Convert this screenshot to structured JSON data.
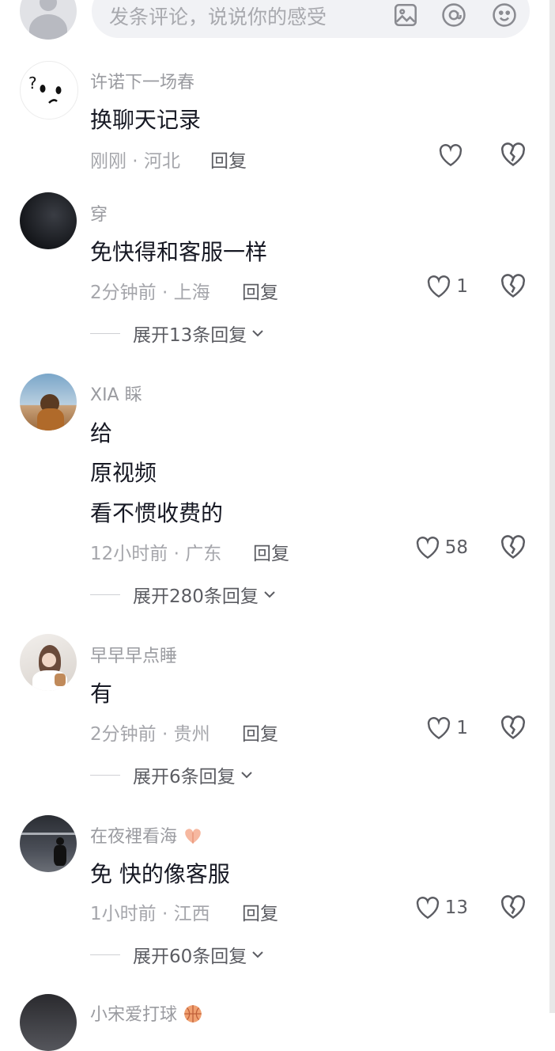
{
  "composer": {
    "placeholder": "发条评论，说说你的感受",
    "icons": [
      "image-icon",
      "at-icon",
      "emoji-icon"
    ]
  },
  "comments": [
    {
      "username": "许诺下一场春",
      "lines": [
        "换聊天记录"
      ],
      "time": "刚刚",
      "location": "河北",
      "reply_label": "回复",
      "likes": "",
      "expand_label": ""
    },
    {
      "username": "穿",
      "lines": [
        "免快得和客服一样"
      ],
      "time": "2分钟前",
      "location": "上海",
      "reply_label": "回复",
      "likes": "1",
      "expand_label": "展开13条回复"
    },
    {
      "username": "XIA 睬",
      "lines": [
        "给",
        "原视频",
        "看不惯收费的"
      ],
      "time": "12小时前",
      "location": "广东",
      "reply_label": "回复",
      "likes": "58",
      "expand_label": "展开280条回复"
    },
    {
      "username": "早早早点睡",
      "lines": [
        "有"
      ],
      "time": "2分钟前",
      "location": "贵州",
      "reply_label": "回复",
      "likes": "1",
      "expand_label": "展开6条回复"
    },
    {
      "username": "在夜裡看海",
      "lines": [
        "免 快的像客服"
      ],
      "time": "1小时前",
      "location": "江西",
      "reply_label": "回复",
      "likes": "13",
      "expand_label": "展开60条回复"
    },
    {
      "username": "小宋爱打球",
      "lines": [],
      "time": "",
      "location": "",
      "reply_label": "",
      "likes": "",
      "expand_label": ""
    }
  ],
  "separator": " · "
}
